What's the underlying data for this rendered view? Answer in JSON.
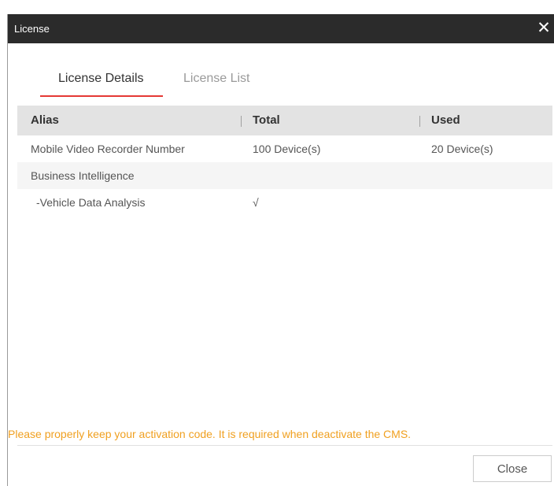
{
  "window": {
    "title": "License"
  },
  "tabs": [
    {
      "label": "License Details",
      "active": true
    },
    {
      "label": "License List",
      "active": false
    }
  ],
  "table": {
    "columns": [
      "Alias",
      "Total",
      "Used"
    ],
    "rows": [
      {
        "alias": "Mobile Video Recorder Number",
        "total": "100 Device(s)",
        "used": "20 Device(s)"
      },
      {
        "alias": "Business Intelligence",
        "total": "",
        "used": ""
      },
      {
        "alias": "-Vehicle Data Analysis",
        "total": "√",
        "used": ""
      }
    ]
  },
  "notice": "Please properly keep your activation code. It is required when deactivate the CMS.",
  "buttons": {
    "close": "Close"
  },
  "colors": {
    "titlebar": "#2b2b2b",
    "active_tab_underline": "#e53935",
    "notice_text": "#f0a020",
    "table_header": "#e3e3e3"
  },
  "icons": {
    "close": "close-icon"
  }
}
